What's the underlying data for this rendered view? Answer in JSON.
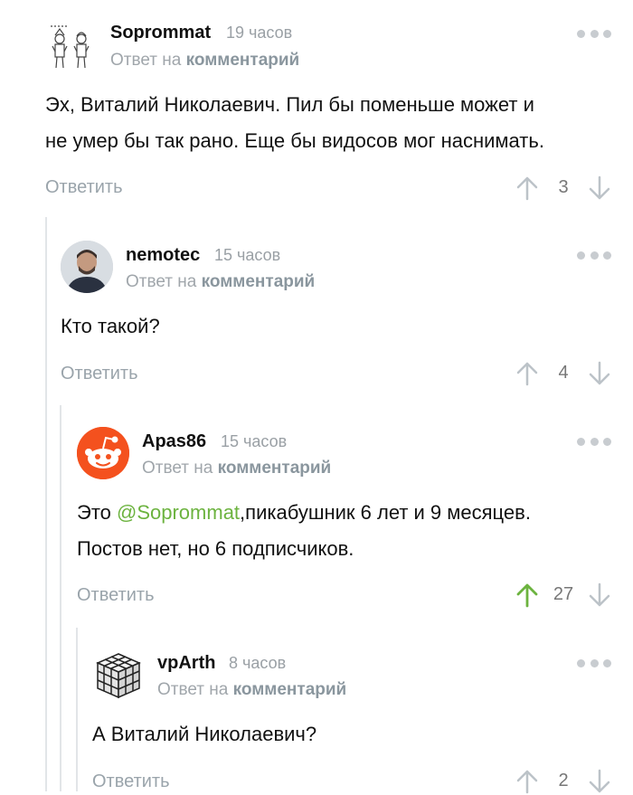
{
  "colors": {
    "accent_green": "#6cb33f",
    "meta_gray": "#9aa0a5",
    "link_gray": "#8a969e",
    "line": "#e2e5e8"
  },
  "comments": [
    {
      "author": "Soprommat",
      "time": "19 часов",
      "reply_prefix": "Ответ на",
      "reply_link": "комментарий",
      "text_lines": [
        "Эх, Виталий Николаевич. Пил бы поменьше может и",
        "не умер бы так рано. Еще бы видосов мог наснимать."
      ],
      "reply_label": "Ответить",
      "score": "3",
      "avatar_icon": "knights-sketch-avatar"
    },
    {
      "author": "nemotec",
      "time": "15 часов",
      "reply_prefix": "Ответ на",
      "reply_link": "комментарий",
      "text_lines": [
        "Кто такой?"
      ],
      "reply_label": "Ответить",
      "score": "4",
      "avatar_icon": "user-photo-avatar"
    },
    {
      "author": "Apas86",
      "time": "15 часов",
      "reply_prefix": "Ответ на",
      "reply_link": "комментарий",
      "text_before": "Это ",
      "mention": "@Soprommat",
      "text_after": ",пикабушник 6 лет и 9 месяцев.",
      "text_line2": "Постов нет, но 6 подписчиков.",
      "reply_label": "Ответить",
      "score": "27",
      "upvoted": true,
      "avatar_icon": "reddit-alien-avatar"
    },
    {
      "author": "vpArth",
      "time": "8 часов",
      "reply_prefix": "Ответ на",
      "reply_link": "комментарий",
      "text_lines": [
        "А Виталий Николаевич?"
      ],
      "reply_label": "Ответить",
      "score": "2",
      "avatar_icon": "rubiks-cube-avatar"
    }
  ]
}
